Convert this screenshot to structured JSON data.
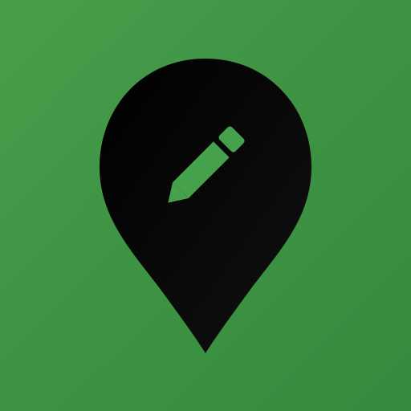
{
  "app_icon": {
    "icon_name": "map-pin-edit-icon",
    "glyph_name": "pencil-icon",
    "colors": {
      "background_light": "#489f4b",
      "background_mid": "#3f9444",
      "background_dark": "#358b3d",
      "pin": "#0b0b0b",
      "pencil": "#45a14b"
    }
  }
}
